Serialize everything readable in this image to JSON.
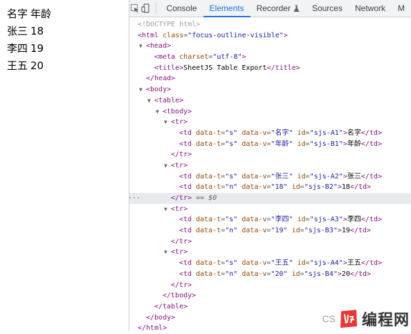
{
  "page": {
    "rows": [
      {
        "c1": "名字",
        "c2": "年龄"
      },
      {
        "c1": "张三",
        "c2": "18"
      },
      {
        "c1": "李四",
        "c2": "19"
      },
      {
        "c1": "王五",
        "c2": "20"
      }
    ]
  },
  "toolbar": {
    "tabs": [
      {
        "label": "Console"
      },
      {
        "label": "Elements"
      },
      {
        "label": "Recorder"
      },
      {
        "label": "Sources"
      },
      {
        "label": "Network"
      },
      {
        "label": "M"
      }
    ],
    "active_tab": "Elements"
  },
  "tree": {
    "doctype": "<!DOCTYPE html>",
    "html_open": "html",
    "html_class_attr": "class",
    "html_class_val": "\"focus-outline-visible\"",
    "meta_text": "meta",
    "meta_attr": "charset",
    "meta_val": "\"utf-8\"",
    "title_text": "SheetJS Table Export",
    "selected_marker": "== $0",
    "cells": [
      {
        "t": "\"s\"",
        "v": "\"名字\"",
        "id": "\"sjs-A1\"",
        "text": "名字"
      },
      {
        "t": "\"s\"",
        "v": "\"年龄\"",
        "id": "\"sjs-B1\"",
        "text": "年龄"
      },
      {
        "t": "\"s\"",
        "v": "\"张三\"",
        "id": "\"sjs-A2\"",
        "text": "张三"
      },
      {
        "t": "\"n\"",
        "v": "\"18\"",
        "id": "\"sjs-B2\"",
        "text": "18"
      },
      {
        "t": "\"s\"",
        "v": "\"李四\"",
        "id": "\"sjs-A3\"",
        "text": "李四"
      },
      {
        "t": "\"n\"",
        "v": "\"19\"",
        "id": "\"sjs-B3\"",
        "text": "19"
      },
      {
        "t": "\"s\"",
        "v": "\"王五\"",
        "id": "\"sjs-A4\"",
        "text": "王五"
      },
      {
        "t": "\"n\"",
        "v": "\"20\"",
        "id": "\"sjs-B4\"",
        "text": "20"
      }
    ]
  },
  "watermark": {
    "cs": "CS",
    "brand": "编程网"
  },
  "colors": {
    "accent": "#1a73e8",
    "tag": "#881280",
    "attr": "#994500",
    "value": "#1a1aa6",
    "logo": "#e53935"
  }
}
